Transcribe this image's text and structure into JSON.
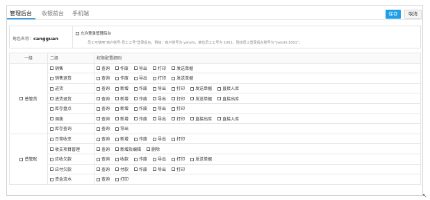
{
  "tabs": [
    {
      "label": "管理后台",
      "active": true
    },
    {
      "label": "收银前台",
      "active": false
    },
    {
      "label": "手机端",
      "active": false
    }
  ],
  "toolbar": {
    "save_label": "保存",
    "cancel_label": "取消"
  },
  "role": {
    "label": "角色名称：",
    "value": "cangguan",
    "allow_label": "允许登录管理后台",
    "hint": "员工可使用\"商户账号-员工工号\"登录后台，例如：商户账号为 yanshi，某位员工工号为 1001，则该员工登录后台账号为\"yanshi:1001\"。"
  },
  "table": {
    "headers": [
      "一级",
      "二级",
      "权限配置细则"
    ],
    "groups": [
      {
        "name": "普管货",
        "rows": [
          {
            "name": "销售",
            "perms": [
              "查询",
              "作废",
              "导出",
              "打印",
              "发送单据"
            ]
          },
          {
            "name": "销售退货",
            "perms": [
              "查询",
              "作废",
              "导出",
              "打印",
              "发送单据"
            ]
          },
          {
            "name": "进货",
            "perms": [
              "查询",
              "新增",
              "作废",
              "导出",
              "打印",
              "发送单据",
              "直接入库"
            ]
          },
          {
            "name": "进货退货",
            "perms": [
              "查询",
              "新增",
              "作废",
              "导出",
              "打印",
              "发送单据",
              "直接出库"
            ]
          },
          {
            "name": "库存盘点",
            "perms": [
              "查询",
              "新增",
              "作废",
              "导出",
              "打印"
            ]
          },
          {
            "name": "调拨",
            "perms": [
              "查询",
              "新增",
              "作废",
              "导出",
              "打印",
              "直接出库",
              "直接入库"
            ]
          },
          {
            "name": "库存查询",
            "perms": [
              "查询",
              "导出"
            ]
          }
        ]
      },
      {
        "name": "普管账",
        "rows": [
          {
            "name": "日常收支",
            "perms": [
              "查询",
              "新增",
              "作废",
              "导出",
              "打印"
            ]
          },
          {
            "name": "收支项目管理",
            "perms": [
              "查询",
              "新增及编辑",
              "删除"
            ]
          },
          {
            "name": "应收欠款",
            "perms": [
              "查询",
              "收款",
              "作废",
              "导出",
              "打印",
              "发送单据"
            ]
          },
          {
            "name": "应付欠款",
            "perms": [
              "查询",
              "付款",
              "作废",
              "导出",
              "打印"
            ]
          },
          {
            "name": "资金流水",
            "perms": [
              "查询",
              "打印"
            ]
          }
        ]
      }
    ]
  }
}
